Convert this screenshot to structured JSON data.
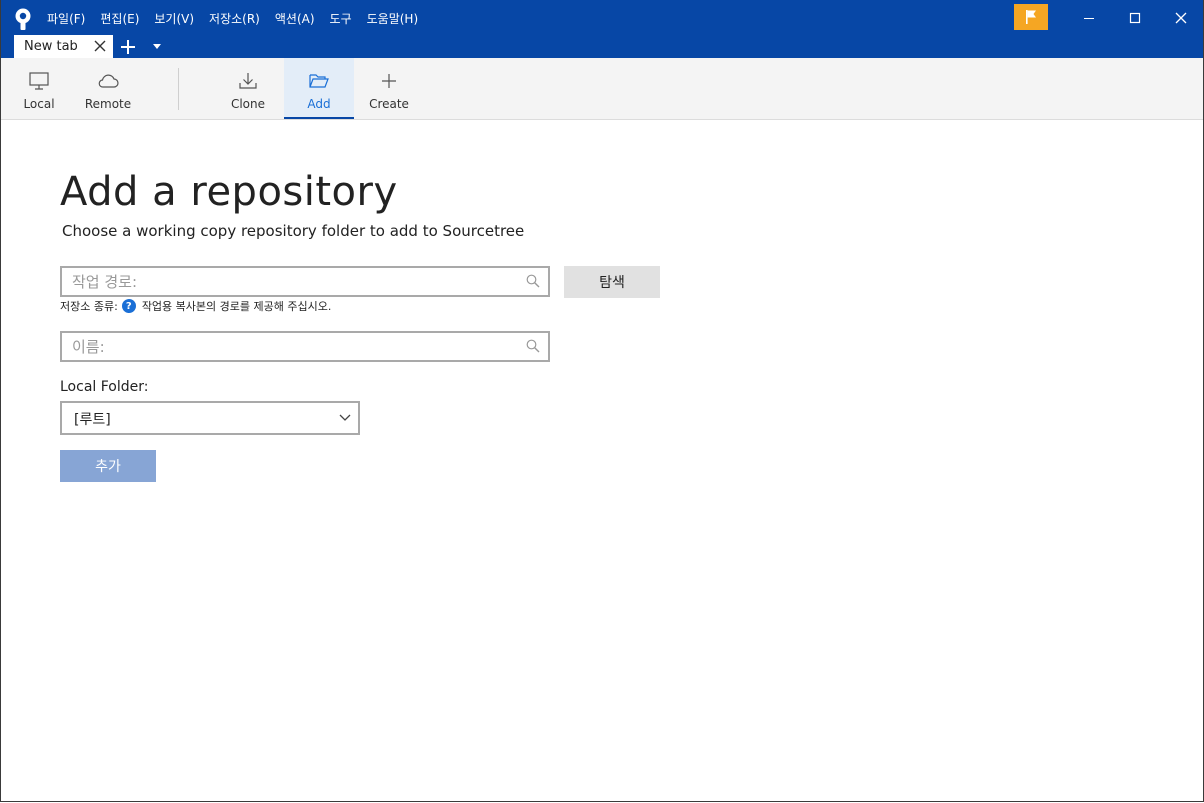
{
  "menu": {
    "items": [
      "파일(F)",
      "편집(E)",
      "보기(V)",
      "저장소(R)",
      "액션(A)",
      "도구",
      "도움말(H)"
    ]
  },
  "tab": {
    "label": "New tab"
  },
  "toolbar": {
    "local": "Local",
    "remote": "Remote",
    "clone": "Clone",
    "add": "Add",
    "create": "Create",
    "active": "add"
  },
  "page": {
    "title": "Add a repository",
    "subtitle": "Choose a working copy repository folder to add to Sourcetree"
  },
  "form": {
    "path_placeholder": "작업 경로:",
    "browse_label": "탐색",
    "repo_type_label": "저장소 종류:",
    "repo_type_help": "?",
    "repo_type_message": "작업용 복사본의 경로를 제공해 주십시오.",
    "name_placeholder": "이름:",
    "local_folder_label": "Local Folder:",
    "local_folder_value": "[루트]",
    "add_button": "추가"
  },
  "colors": {
    "titlebar": "#0747a6",
    "accent": "#1a6fd6",
    "flag": "#f5a623",
    "add_button_disabled": "#87a5d5"
  },
  "icons": {
    "app": "sourcetree-logo-icon",
    "flag": "flag-icon",
    "local": "monitor-icon",
    "remote": "cloud-icon",
    "clone": "download-icon",
    "add": "folder-open-icon",
    "create": "plus-icon",
    "search": "search-icon",
    "chevron": "chevron-down-icon"
  }
}
